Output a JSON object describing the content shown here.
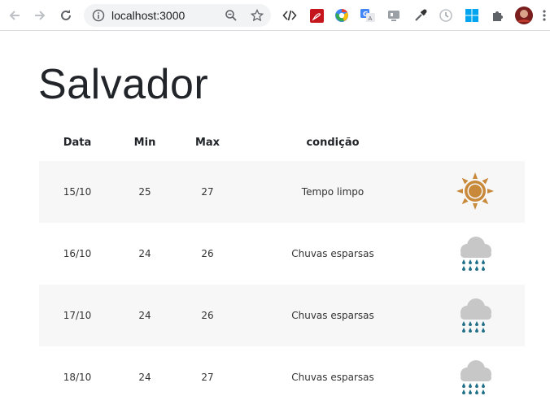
{
  "browser": {
    "url": "localhost:3000",
    "extensions": [
      "code-icon",
      "pdf-icon",
      "chrome-color-icon",
      "translate-icon",
      "cast-icon",
      "eyedropper-icon",
      "clock-icon",
      "windows-icon",
      "puzzle-icon",
      "avatar"
    ]
  },
  "page": {
    "title": "Salvador"
  },
  "table": {
    "headers": {
      "date": "Data",
      "min": "Min",
      "max": "Max",
      "condition": "condição"
    },
    "rows": [
      {
        "date": "15/10",
        "min": "25",
        "max": "27",
        "condition": "Tempo limpo",
        "icon": "sun-icon"
      },
      {
        "date": "16/10",
        "min": "24",
        "max": "26",
        "condition": "Chuvas esparsas",
        "icon": "rain-cloud-icon"
      },
      {
        "date": "17/10",
        "min": "24",
        "max": "26",
        "condition": "Chuvas esparsas",
        "icon": "rain-cloud-icon"
      },
      {
        "date": "18/10",
        "min": "24",
        "max": "27",
        "condition": "Chuvas esparsas",
        "icon": "rain-cloud-icon"
      }
    ]
  },
  "colors": {
    "sun": "#c8893a",
    "cloud": "#c7c7c7",
    "rain": "#1f6f86",
    "row_alt": "#f7f7f7"
  }
}
